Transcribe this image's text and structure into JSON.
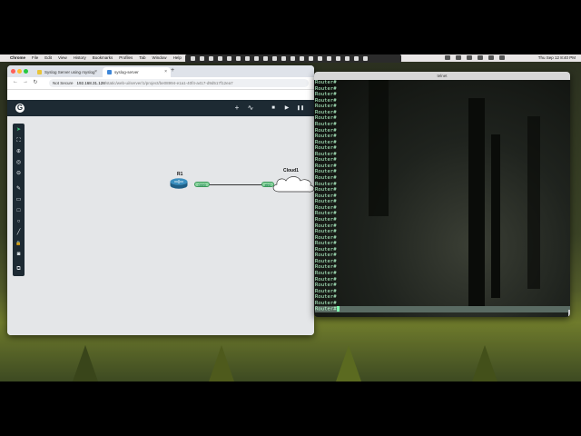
{
  "menubar": {
    "app": "Chrome",
    "items": [
      "File",
      "Edit",
      "View",
      "History",
      "Bookmarks",
      "Profiles",
      "Tab",
      "Window",
      "Help"
    ],
    "clock": "Thu Sep 12  8:40 PM"
  },
  "browser": {
    "tabs": [
      {
        "label": "Syslog Server using rsyslog",
        "active": false,
        "favicon_color": "#e9c43a"
      },
      {
        "label": "syslog-server",
        "active": true,
        "favicon_color": "#3d86d8"
      }
    ],
    "new_tab": "+",
    "close": "×",
    "security": "Not Secure",
    "url_host": "192.168.31.128",
    "url_path": "/static/web-ui/server/1/project/be08994-e1a1-40f4-a417-d9d517f12ea7"
  },
  "gns3": {
    "logo": "G",
    "toolbar": [
      {
        "name": "add-icon",
        "glyph": "+"
      },
      {
        "name": "activity-icon",
        "glyph": "∿"
      },
      {
        "name": "stop-icon",
        "glyph": "■"
      },
      {
        "name": "start-icon",
        "glyph": "▶"
      },
      {
        "name": "pause-icon",
        "glyph": "❚❚"
      }
    ],
    "left_tools": [
      {
        "name": "select-icon",
        "glyph": "➤"
      },
      {
        "name": "fit-icon",
        "glyph": "⛶"
      },
      {
        "name": "zoom-in-icon",
        "glyph": "⊕"
      },
      {
        "name": "reset-zoom-icon",
        "glyph": "◎"
      },
      {
        "name": "zoom-out-icon",
        "glyph": "⊖"
      },
      {
        "name": "draw-line-icon",
        "glyph": "✎"
      },
      {
        "name": "rectangle-icon",
        "glyph": "▭"
      },
      {
        "name": "square-icon",
        "glyph": "□"
      },
      {
        "name": "circle-icon",
        "glyph": "○"
      },
      {
        "name": "line-icon",
        "glyph": "╱"
      },
      {
        "name": "lock-icon",
        "glyph": "🔒"
      },
      {
        "name": "camera-icon",
        "glyph": "◙"
      },
      {
        "name": "layers-icon",
        "glyph": "⧉"
      }
    ],
    "nodes": {
      "router_label": "R1",
      "router_port": "Gi0/0",
      "cloud_label": "Cloud1",
      "cloud_port": "eth0"
    }
  },
  "terminal": {
    "title": "telnet",
    "lines": [
      "Router#",
      "Router#",
      "Router#",
      "Router#",
      "Router#",
      "Router#",
      "Router#",
      "Router#",
      "Router#",
      "Router#",
      "Router#",
      "Router#",
      "Router#",
      "Router#",
      "Router#",
      "Router#",
      "Router#",
      "Router#",
      "Router#",
      "Router#",
      "Router#",
      "Router#",
      "Router#",
      "Router#",
      "Router#",
      "Router#",
      "Router#",
      "Router#",
      "Router#",
      "Router#",
      "Router#",
      "Router#",
      "Router#",
      "Router#",
      "Router#",
      "Router#",
      "Router#",
      "Router#"
    ],
    "prompt": "Router#"
  }
}
